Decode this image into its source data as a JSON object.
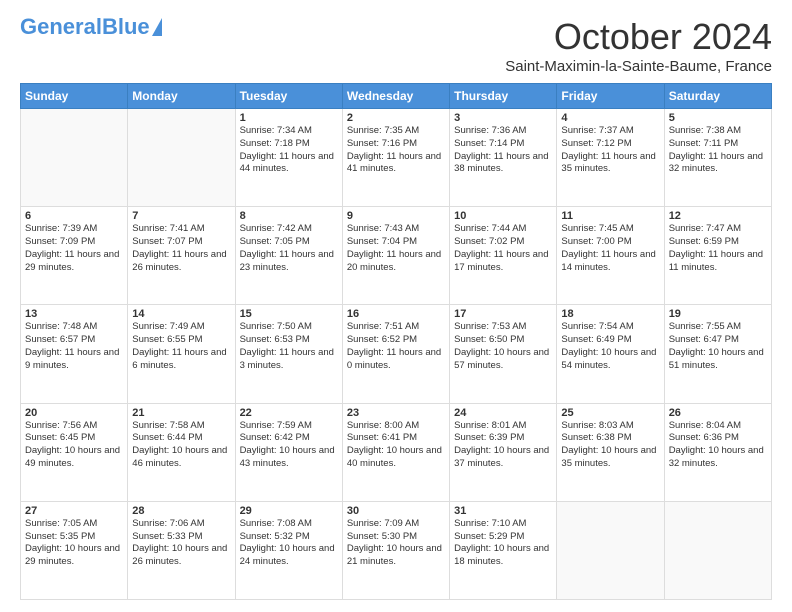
{
  "logo": {
    "text_general": "General",
    "text_blue": "Blue"
  },
  "title": "October 2024",
  "location": "Saint-Maximin-la-Sainte-Baume, France",
  "days_of_week": [
    "Sunday",
    "Monday",
    "Tuesday",
    "Wednesday",
    "Thursday",
    "Friday",
    "Saturday"
  ],
  "weeks": [
    [
      {
        "day": "",
        "empty": true
      },
      {
        "day": "",
        "empty": true
      },
      {
        "day": "1",
        "sunrise": "7:34 AM",
        "sunset": "7:18 PM",
        "daylight": "11 hours and 44 minutes."
      },
      {
        "day": "2",
        "sunrise": "7:35 AM",
        "sunset": "7:16 PM",
        "daylight": "11 hours and 41 minutes."
      },
      {
        "day": "3",
        "sunrise": "7:36 AM",
        "sunset": "7:14 PM",
        "daylight": "11 hours and 38 minutes."
      },
      {
        "day": "4",
        "sunrise": "7:37 AM",
        "sunset": "7:12 PM",
        "daylight": "11 hours and 35 minutes."
      },
      {
        "day": "5",
        "sunrise": "7:38 AM",
        "sunset": "7:11 PM",
        "daylight": "11 hours and 32 minutes."
      }
    ],
    [
      {
        "day": "6",
        "sunrise": "7:39 AM",
        "sunset": "7:09 PM",
        "daylight": "11 hours and 29 minutes."
      },
      {
        "day": "7",
        "sunrise": "7:41 AM",
        "sunset": "7:07 PM",
        "daylight": "11 hours and 26 minutes."
      },
      {
        "day": "8",
        "sunrise": "7:42 AM",
        "sunset": "7:05 PM",
        "daylight": "11 hours and 23 minutes."
      },
      {
        "day": "9",
        "sunrise": "7:43 AM",
        "sunset": "7:04 PM",
        "daylight": "11 hours and 20 minutes."
      },
      {
        "day": "10",
        "sunrise": "7:44 AM",
        "sunset": "7:02 PM",
        "daylight": "11 hours and 17 minutes."
      },
      {
        "day": "11",
        "sunrise": "7:45 AM",
        "sunset": "7:00 PM",
        "daylight": "11 hours and 14 minutes."
      },
      {
        "day": "12",
        "sunrise": "7:47 AM",
        "sunset": "6:59 PM",
        "daylight": "11 hours and 11 minutes."
      }
    ],
    [
      {
        "day": "13",
        "sunrise": "7:48 AM",
        "sunset": "6:57 PM",
        "daylight": "11 hours and 9 minutes."
      },
      {
        "day": "14",
        "sunrise": "7:49 AM",
        "sunset": "6:55 PM",
        "daylight": "11 hours and 6 minutes."
      },
      {
        "day": "15",
        "sunrise": "7:50 AM",
        "sunset": "6:53 PM",
        "daylight": "11 hours and 3 minutes."
      },
      {
        "day": "16",
        "sunrise": "7:51 AM",
        "sunset": "6:52 PM",
        "daylight": "11 hours and 0 minutes."
      },
      {
        "day": "17",
        "sunrise": "7:53 AM",
        "sunset": "6:50 PM",
        "daylight": "10 hours and 57 minutes."
      },
      {
        "day": "18",
        "sunrise": "7:54 AM",
        "sunset": "6:49 PM",
        "daylight": "10 hours and 54 minutes."
      },
      {
        "day": "19",
        "sunrise": "7:55 AM",
        "sunset": "6:47 PM",
        "daylight": "10 hours and 51 minutes."
      }
    ],
    [
      {
        "day": "20",
        "sunrise": "7:56 AM",
        "sunset": "6:45 PM",
        "daylight": "10 hours and 49 minutes."
      },
      {
        "day": "21",
        "sunrise": "7:58 AM",
        "sunset": "6:44 PM",
        "daylight": "10 hours and 46 minutes."
      },
      {
        "day": "22",
        "sunrise": "7:59 AM",
        "sunset": "6:42 PM",
        "daylight": "10 hours and 43 minutes."
      },
      {
        "day": "23",
        "sunrise": "8:00 AM",
        "sunset": "6:41 PM",
        "daylight": "10 hours and 40 minutes."
      },
      {
        "day": "24",
        "sunrise": "8:01 AM",
        "sunset": "6:39 PM",
        "daylight": "10 hours and 37 minutes."
      },
      {
        "day": "25",
        "sunrise": "8:03 AM",
        "sunset": "6:38 PM",
        "daylight": "10 hours and 35 minutes."
      },
      {
        "day": "26",
        "sunrise": "8:04 AM",
        "sunset": "6:36 PM",
        "daylight": "10 hours and 32 minutes."
      }
    ],
    [
      {
        "day": "27",
        "sunrise": "7:05 AM",
        "sunset": "5:35 PM",
        "daylight": "10 hours and 29 minutes."
      },
      {
        "day": "28",
        "sunrise": "7:06 AM",
        "sunset": "5:33 PM",
        "daylight": "10 hours and 26 minutes."
      },
      {
        "day": "29",
        "sunrise": "7:08 AM",
        "sunset": "5:32 PM",
        "daylight": "10 hours and 24 minutes."
      },
      {
        "day": "30",
        "sunrise": "7:09 AM",
        "sunset": "5:30 PM",
        "daylight": "10 hours and 21 minutes."
      },
      {
        "day": "31",
        "sunrise": "7:10 AM",
        "sunset": "5:29 PM",
        "daylight": "10 hours and 18 minutes."
      },
      {
        "day": "",
        "empty": true
      },
      {
        "day": "",
        "empty": true
      }
    ]
  ]
}
